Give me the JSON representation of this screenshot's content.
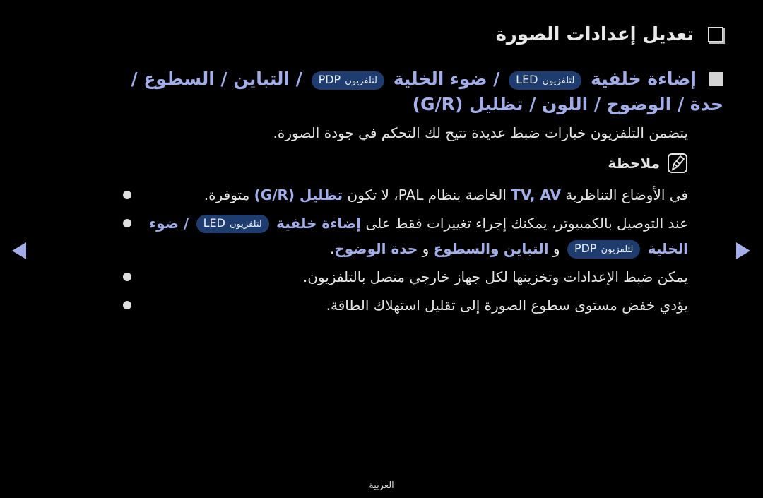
{
  "title": {
    "icon": "checkbox-square-icon",
    "text": "تعديل إعدادات الصورة"
  },
  "heading": {
    "icon": "filled-square-icon",
    "part1": "إضاءة خلفية",
    "pill1": {
      "model": "LED",
      "label": "لتلفزيون"
    },
    "part2": "/ ضوء الخلية",
    "pill2": {
      "model": "PDP",
      "label": "لتلفزيون"
    },
    "part3": "/ التباين / السطوع / حدة / الوضوح / اللون / تظليل (G/R)"
  },
  "description": "يتضمن التلفزيون خيارات ضبط عديدة تتيح لك التحكم في جودة الصورة.",
  "note": {
    "icon": "note-pencil-icon",
    "label": "ملاحظة"
  },
  "bullets": [
    {
      "pre": "في الأوضاع التناظرية",
      "hl1": "TV, AV",
      "mid": "الخاصة بنظام PAL، لا تكون",
      "hl2": "تظليل (G/R)",
      "post": "متوفرة."
    },
    {
      "pre": "عند التوصيل بالكمبيوتر، يمكنك إجراء تغييرات فقط على",
      "hl1": "إضاءة خلفية",
      "pill1": {
        "model": "LED",
        "label": "لتلفزيون"
      },
      "hl2": "/ ضوء الخلية",
      "pill2": {
        "model": "PDP",
        "label": "لتلفزيون"
      },
      "and1": "و",
      "hl3": "التباين",
      "and2": "والسطوع",
      "and3": "و",
      "hl4": "حدة الوضوح",
      "post": "."
    },
    {
      "text": "يمكن ضبط الإعدادات وتخزينها لكل جهاز خارجي متصل بالتلفزيون."
    },
    {
      "text": "يؤدي خفض مستوى سطوع الصورة إلى تقليل استهلاك الطاقة."
    }
  ],
  "nav": {
    "prev_icon": "arrow-left-icon",
    "next_icon": "arrow-right-icon"
  },
  "footer": {
    "language": "العربية"
  },
  "colors": {
    "background": "#000000",
    "highlight": "#a3aee8",
    "pill": "#1e3c6e",
    "text": "#e6e6e6"
  }
}
